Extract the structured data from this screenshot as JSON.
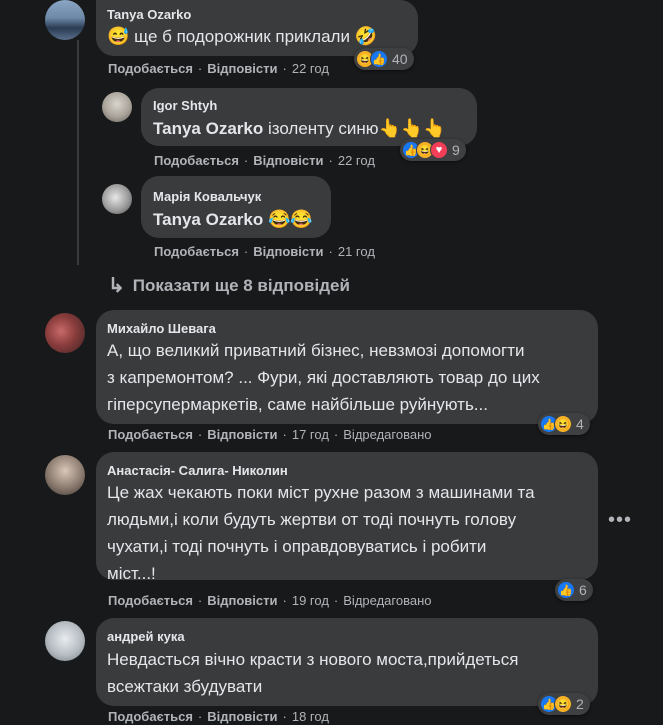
{
  "actions": {
    "like": "Подобається",
    "reply": "Відповісти",
    "separator": "·"
  },
  "show_more_replies": "Показати ще 8 відповідей",
  "comments": [
    {
      "author": "Tanya Ozarko",
      "emoji_prefix": "😅",
      "text": " ще б подорожник приклали ",
      "emoji_suffix": "🤣",
      "time": "22 год",
      "reactions": [
        "haha",
        "like"
      ],
      "reaction_count": "40"
    },
    {
      "author": "Igor Shtyh",
      "mention": "Tanya Ozarko",
      "text": " ізоленту синю",
      "emoji_suffix": "👆👆👆",
      "time": "22 год",
      "reactions": [
        "like",
        "haha",
        "love"
      ],
      "reaction_count": "9"
    },
    {
      "author": "Марія Ковальчук",
      "mention": "Tanya Ozarko",
      "text": " ",
      "emoji_suffix": "😂😂",
      "time": "21 год"
    },
    {
      "author": "Михайло Шевага",
      "text_lines": [
        "А, що великий приватний бізнес, невзмозі допомогти",
        "з капремонтом? ... Фури, які доставляють товар до цих",
        "гіперсупермаркетів, саме найбільше руйнують..."
      ],
      "time": "17 год",
      "edited": "Відредаговано",
      "reactions": [
        "like",
        "haha"
      ],
      "reaction_count": "4"
    },
    {
      "author": "Анастасія- Салига- Николин",
      "text_lines": [
        "Це жах чекають поки міст рухне разом з машинами та",
        "людьми,і коли будуть жертви от тоді почнуть голову",
        "чухати,і тоді почнуть і оправдовуватись і робити",
        "міст...!"
      ],
      "time": "19 год",
      "edited": "Відредаговано",
      "reactions": [
        "like"
      ],
      "reaction_count": "6"
    },
    {
      "author": "андрей кука",
      "text_lines": [
        "Невдасться вічно красти з нового моста,прийдеться",
        "всежтаки збудувати"
      ],
      "time": "18 год",
      "reactions": [
        "like",
        "haha"
      ],
      "reaction_count": "2"
    }
  ],
  "icons": {
    "reply_arrow": "reply-arrow-icon",
    "more": "more-options-icon"
  },
  "colors": {
    "background": "#18191a",
    "bubble": "#3a3b3c",
    "like": "#1877f2",
    "haha": "#f7b125",
    "love": "#f33e58"
  }
}
